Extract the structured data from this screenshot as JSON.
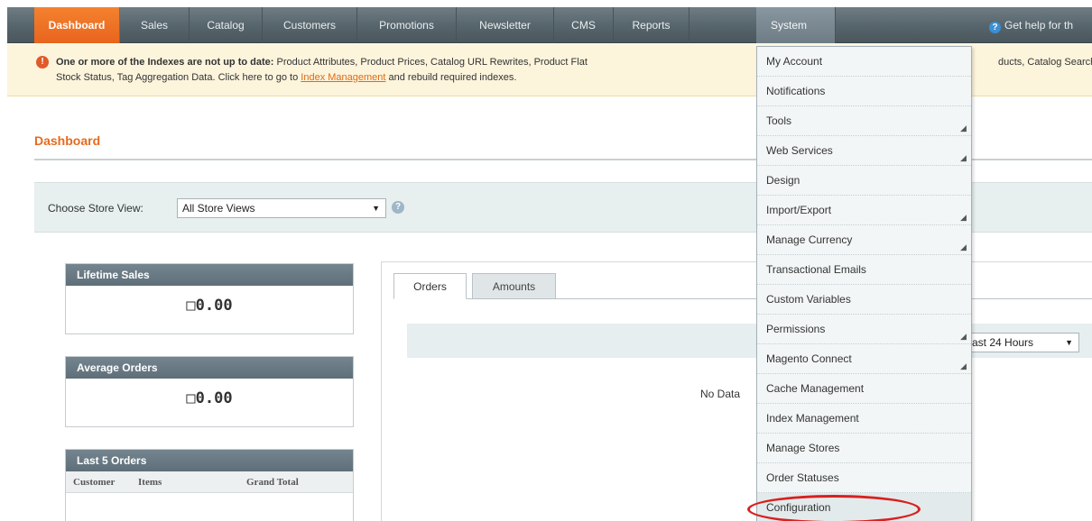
{
  "nav": {
    "items": [
      "Dashboard",
      "Sales",
      "Catalog",
      "Customers",
      "Promotions",
      "Newsletter",
      "CMS",
      "Reports",
      "System"
    ],
    "help": "Get help for th"
  },
  "notice": {
    "bold": "One or more of the Indexes are not up to date:",
    "line1_rest": " Product Attributes, Product Prices, Catalog URL Rewrites, Product Flat",
    "line1_right": "ducts, Catalog Search",
    "line2_a": "Stock Status, Tag Aggregation Data. Click here to go to ",
    "line2_link": "Index Management",
    "line2_b": " and rebuild required indexes."
  },
  "page": {
    "title": "Dashboard"
  },
  "store": {
    "label": "Choose Store View:",
    "selected": "All Store Views",
    "arrow": "▼"
  },
  "boxes": {
    "lifetime": {
      "title": "Lifetime Sales",
      "value": "□0.00"
    },
    "average": {
      "title": "Average Orders",
      "value": "□0.00"
    },
    "last5": {
      "title": "Last 5 Orders",
      "cols": [
        "Customer",
        "Items",
        "Grand Total"
      ]
    }
  },
  "tabs": {
    "orders": "Orders",
    "amounts": "Amounts"
  },
  "chart": {
    "range": "ast 24 Hours",
    "arrow": "▼",
    "no_data": "No Data"
  },
  "menu": {
    "items": [
      {
        "label": "My Account",
        "sub": false
      },
      {
        "label": "Notifications",
        "sub": false
      },
      {
        "label": "Tools",
        "sub": true
      },
      {
        "label": "Web Services",
        "sub": true
      },
      {
        "label": "Design",
        "sub": false
      },
      {
        "label": "Import/Export",
        "sub": true
      },
      {
        "label": "Manage Currency",
        "sub": true
      },
      {
        "label": "Transactional Emails",
        "sub": false
      },
      {
        "label": "Custom Variables",
        "sub": false
      },
      {
        "label": "Permissions",
        "sub": true
      },
      {
        "label": "Magento Connect",
        "sub": true
      },
      {
        "label": "Cache Management",
        "sub": false
      },
      {
        "label": "Index Management",
        "sub": false
      },
      {
        "label": "Manage Stores",
        "sub": false
      },
      {
        "label": "Order Statuses",
        "sub": false
      },
      {
        "label": "Configuration",
        "sub": false
      }
    ],
    "sub_glyph": "◢"
  },
  "colors": {
    "accent": "#e8641d",
    "nav_bg": "#56646b",
    "highlight": "#d8201f"
  }
}
